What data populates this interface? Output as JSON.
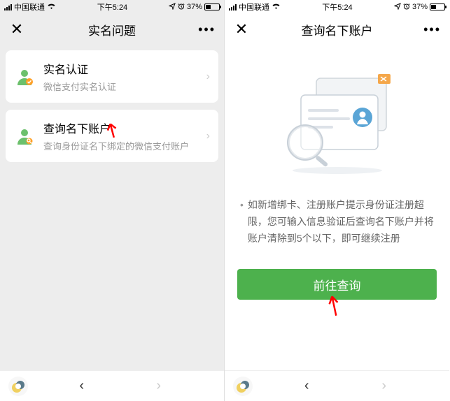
{
  "status": {
    "carrier": "中国联通",
    "time": "下午5:24",
    "battery_pct": "37%"
  },
  "left": {
    "title": "实名问题",
    "items": [
      {
        "title": "实名认证",
        "sub": "微信支付实名认证"
      },
      {
        "title": "查询名下账户",
        "sub": "查询身份证名下绑定的微信支付账户"
      }
    ]
  },
  "right": {
    "title": "查询名下账户",
    "desc": "如新增绑卡、注册账户提示身份证注册超限，您可输入信息验证后查询名下账户并将账户清除到5个以下，即可继续注册",
    "button": "前往查询"
  }
}
